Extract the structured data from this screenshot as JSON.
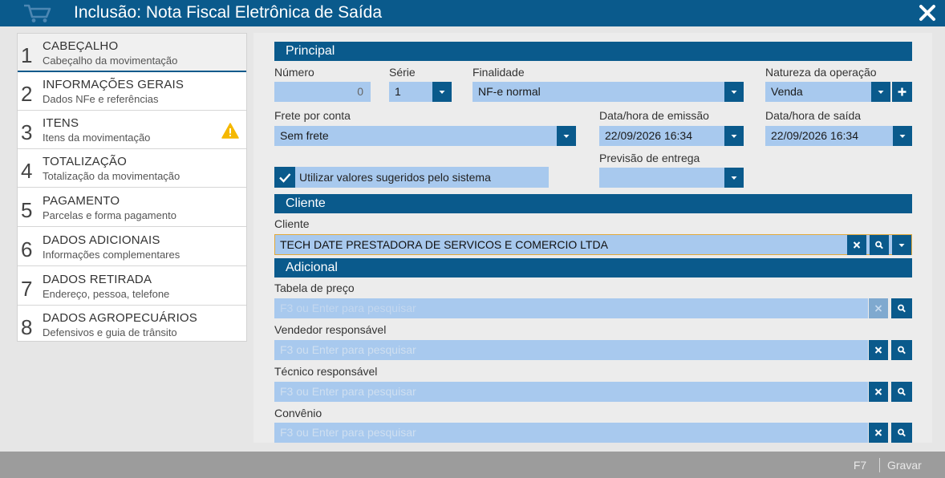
{
  "window": {
    "title": "Inclusão: Nota Fiscal Eletrônica de Saída",
    "accent_color": "#0a5a8c",
    "field_color": "#a8c9ee"
  },
  "steps": [
    {
      "num": "1",
      "label": "CABEÇALHO",
      "sub": "Cabeçalho da movimentação",
      "active": true
    },
    {
      "num": "2",
      "label": "INFORMAÇÕES GERAIS",
      "sub": "Dados NFe e referências"
    },
    {
      "num": "3",
      "label": "ITENS",
      "sub": "Itens da movimentação",
      "icon": "warning-icon"
    },
    {
      "num": "4",
      "label": "TOTALIZAÇÃO",
      "sub": "Totalização da movimentação"
    },
    {
      "num": "5",
      "label": "PAGAMENTO",
      "sub": "Parcelas e forma pagamento"
    },
    {
      "num": "6",
      "label": "DADOS ADICIONAIS",
      "sub": "Informações complementares"
    },
    {
      "num": "7",
      "label": "DADOS RETIRADA",
      "sub": "Endereço, pessoa, telefone"
    },
    {
      "num": "8",
      "label": "DADOS AGROPECUÁRIOS",
      "sub": "Defensivos e guia de trânsito"
    }
  ],
  "principal": {
    "section_title": "Principal",
    "numero": {
      "label": "Número",
      "value": "0"
    },
    "serie": {
      "label": "Série",
      "value": "1"
    },
    "finalidade": {
      "label": "Finalidade",
      "value": "NF-e normal"
    },
    "natureza": {
      "label": "Natureza da operação",
      "value": "Venda"
    },
    "frete": {
      "label": "Frete por conta",
      "value": "Sem frete"
    },
    "emissao": {
      "label": "Data/hora de emissão",
      "value": "22/09/2026 16:34"
    },
    "saida": {
      "label": "Data/hora de saída",
      "value": "22/09/2026 16:34"
    },
    "previsao": {
      "label": "Previsão de entrega",
      "value": ""
    },
    "checkbox": {
      "label": "Utilizar valores sugeridos pelo sistema",
      "checked": true
    }
  },
  "cliente": {
    "section_title": "Cliente",
    "label": "Cliente",
    "value": "TECH DATE PRESTADORA DE SERVICOS E COMERCIO LTDA"
  },
  "adicional": {
    "section_title": "Adicional",
    "tabela": {
      "label": "Tabela de preço",
      "placeholder": "F3 ou Enter para pesquisar"
    },
    "vendedor": {
      "label": "Vendedor responsável",
      "placeholder": "F3 ou Enter para pesquisar"
    },
    "tecnico": {
      "label": "Técnico responsável",
      "placeholder": "F3 ou Enter para pesquisar"
    },
    "convenio": {
      "label": "Convênio",
      "placeholder": "F3 ou Enter para pesquisar"
    }
  },
  "footer": {
    "shortcut": "F7",
    "save_label": "Gravar"
  }
}
